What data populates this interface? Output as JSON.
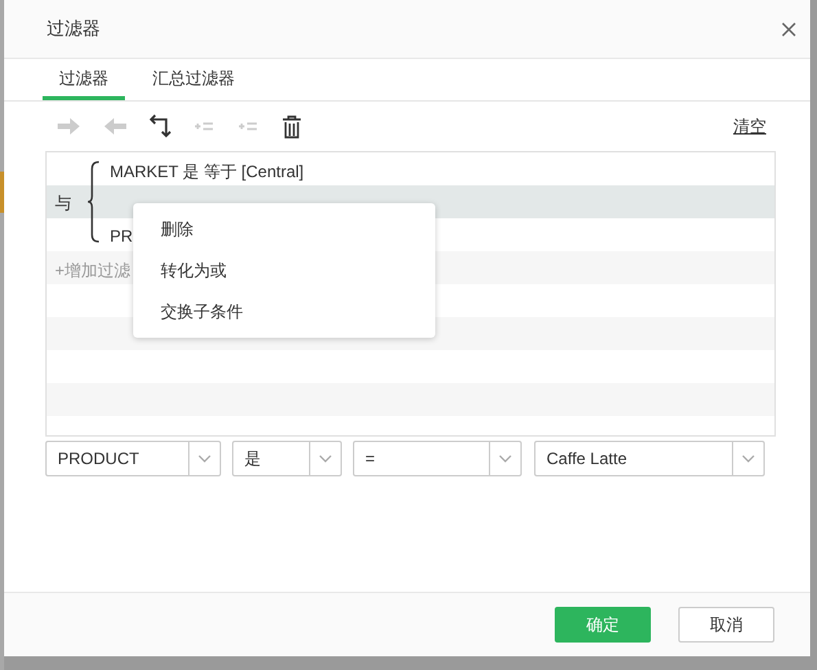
{
  "window": {
    "title": "过滤器"
  },
  "tabs": [
    {
      "label": "过滤器",
      "selected": true
    },
    {
      "label": "汇总过滤器",
      "selected": false
    }
  ],
  "toolbar": {
    "tools": [
      {
        "kind": "right",
        "disabled": true
      },
      {
        "kind": "left",
        "disabled": true
      },
      {
        "kind": "swap",
        "disabled": false
      },
      {
        "kind": "add-a",
        "disabled": true
      },
      {
        "kind": "add-b",
        "disabled": true
      },
      {
        "kind": "trash",
        "disabled": false
      }
    ],
    "clear_link": "清空"
  },
  "filter_tree": {
    "operator": "与",
    "conditions": [
      {
        "text": "MARKET 是 等于 [Central]"
      },
      {
        "text": "PR"
      }
    ],
    "add_link": "+增加过滤",
    "operator_row_selected": true
  },
  "context_menu": {
    "items": [
      {
        "label": "删除"
      },
      {
        "label": "转化为或"
      },
      {
        "label": "交换子条件"
      }
    ]
  },
  "editor": {
    "field": "PRODUCT",
    "mode": "是",
    "operator": "=",
    "value": "Caffe Latte"
  },
  "buttons": [
    {
      "label": "确定",
      "kind": "primary"
    },
    {
      "label": "取消",
      "kind": "secondary"
    }
  ]
}
